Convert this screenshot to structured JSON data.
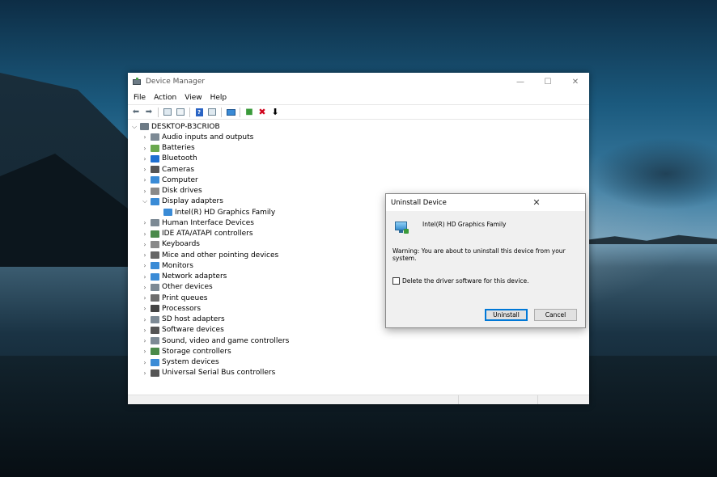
{
  "window": {
    "title": "Device Manager",
    "controls": {
      "minimize": "—",
      "maximize": "☐",
      "close": "✕"
    }
  },
  "menu": [
    "File",
    "Action",
    "View",
    "Help"
  ],
  "tree": {
    "root": "DESKTOP-B3CRIOB",
    "items": [
      {
        "label": "Audio inputs and outputs",
        "expanded": false,
        "icon": "speaker-icon",
        "color": "#7d8a95"
      },
      {
        "label": "Batteries",
        "expanded": false,
        "icon": "battery-icon",
        "color": "#6aa84f"
      },
      {
        "label": "Bluetooth",
        "expanded": false,
        "icon": "bluetooth-icon",
        "color": "#1e6fd0"
      },
      {
        "label": "Cameras",
        "expanded": false,
        "icon": "camera-icon",
        "color": "#555555"
      },
      {
        "label": "Computer",
        "expanded": false,
        "icon": "computer-icon",
        "color": "#3a8bd6"
      },
      {
        "label": "Disk drives",
        "expanded": false,
        "icon": "disk-icon",
        "color": "#8a8a8a"
      },
      {
        "label": "Display adapters",
        "expanded": true,
        "icon": "display-adapter-icon",
        "color": "#3a8bd6",
        "children": [
          {
            "label": "Intel(R) HD Graphics Family",
            "icon": "monitor-icon",
            "color": "#3a8bd6"
          }
        ]
      },
      {
        "label": "Human Interface Devices",
        "expanded": false,
        "icon": "hid-icon",
        "color": "#7d8a95"
      },
      {
        "label": "IDE ATA/ATAPI controllers",
        "expanded": false,
        "icon": "ide-icon",
        "color": "#4a8a4a"
      },
      {
        "label": "Keyboards",
        "expanded": false,
        "icon": "keyboard-icon",
        "color": "#8a8a8a"
      },
      {
        "label": "Mice and other pointing devices",
        "expanded": false,
        "icon": "mouse-icon",
        "color": "#666666"
      },
      {
        "label": "Monitors",
        "expanded": false,
        "icon": "monitor-icon",
        "color": "#3a8bd6"
      },
      {
        "label": "Network adapters",
        "expanded": false,
        "icon": "network-icon",
        "color": "#3a8bd6"
      },
      {
        "label": "Other devices",
        "expanded": false,
        "icon": "other-devices-icon",
        "color": "#7d8a95"
      },
      {
        "label": "Print queues",
        "expanded": false,
        "icon": "printer-icon",
        "color": "#6d6d6d"
      },
      {
        "label": "Processors",
        "expanded": false,
        "icon": "processor-icon",
        "color": "#444444"
      },
      {
        "label": "SD host adapters",
        "expanded": false,
        "icon": "sd-card-icon",
        "color": "#7d8a95"
      },
      {
        "label": "Software devices",
        "expanded": false,
        "icon": "software-device-icon",
        "color": "#555555"
      },
      {
        "label": "Sound, video and game controllers",
        "expanded": false,
        "icon": "speaker-icon",
        "color": "#7d8a95"
      },
      {
        "label": "Storage controllers",
        "expanded": false,
        "icon": "storage-icon",
        "color": "#4a8a4a"
      },
      {
        "label": "System devices",
        "expanded": false,
        "icon": "system-device-icon",
        "color": "#3a8bd6"
      },
      {
        "label": "Universal Serial Bus controllers",
        "expanded": false,
        "icon": "usb-icon",
        "color": "#555555"
      }
    ]
  },
  "dialog": {
    "title": "Uninstall Device",
    "close": "✕",
    "device_name": "Intel(R) HD Graphics Family",
    "warning": "Warning: You are about to uninstall this device from your system.",
    "checkbox_label": "Delete the driver software for this device.",
    "checkbox_checked": false,
    "uninstall_label": "Uninstall",
    "cancel_label": "Cancel"
  },
  "colors": {
    "accent": "#0078d7",
    "delete_red": "#d0021b"
  }
}
